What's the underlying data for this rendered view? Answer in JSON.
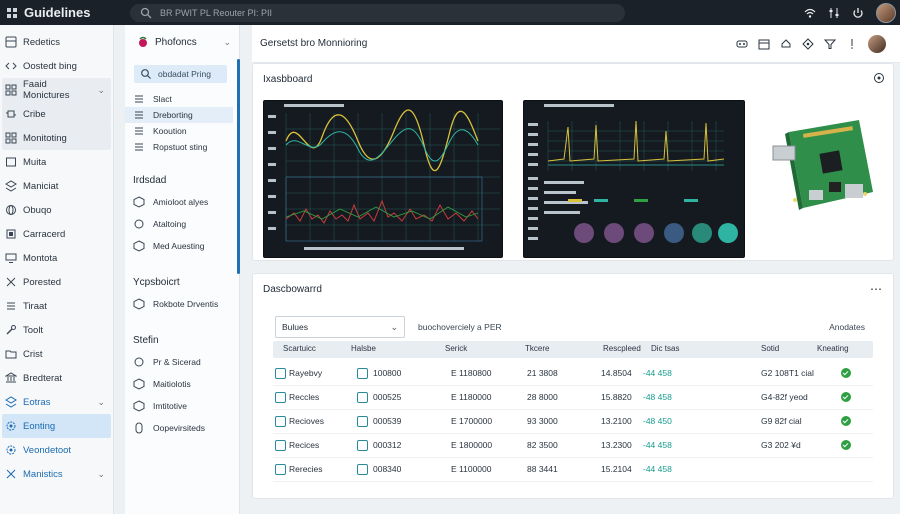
{
  "topbar": {
    "title": "Guidelines",
    "search_text": "BR PWIT PL Reouter PI: PII",
    "icons": [
      "apps-icon",
      "search-icon",
      "wifi-icon",
      "settings-sliders-icon",
      "power-icon",
      "avatar"
    ]
  },
  "rail": {
    "items": [
      {
        "label": "Redetics",
        "icon": "dashboard-icon",
        "boxed": false,
        "active": false,
        "blue": false,
        "chevron": false
      },
      {
        "label": "Oostedt bing",
        "icon": "code-icon",
        "boxed": false,
        "active": false,
        "blue": false,
        "chevron": false
      },
      {
        "label": "Faaid Monictures",
        "icon": "grid-icon",
        "boxed": true,
        "active": false,
        "blue": false,
        "chevron": true
      },
      {
        "label": "Cribe",
        "icon": "chip-icon",
        "boxed": true,
        "active": false,
        "blue": false,
        "chevron": false
      },
      {
        "label": "Monitoting",
        "icon": "grid-icon",
        "boxed": true,
        "active": false,
        "blue": false,
        "chevron": false
      },
      {
        "label": "Muita",
        "icon": "box-icon",
        "boxed": false,
        "active": false,
        "blue": false,
        "chevron": false
      },
      {
        "label": "Maniciat",
        "icon": "layers-icon",
        "boxed": false,
        "active": false,
        "blue": false,
        "chevron": false
      },
      {
        "label": "Obuqo",
        "icon": "globe-icon",
        "boxed": false,
        "active": false,
        "blue": false,
        "chevron": false
      },
      {
        "label": "Carracerd",
        "icon": "cpu-icon",
        "boxed": false,
        "active": false,
        "blue": false,
        "chevron": false
      },
      {
        "label": "Montota",
        "icon": "monitor-icon",
        "boxed": false,
        "active": false,
        "blue": false,
        "chevron": false
      },
      {
        "label": "Porested",
        "icon": "tools-icon",
        "boxed": false,
        "active": false,
        "blue": false,
        "chevron": false
      },
      {
        "label": "Tiraat",
        "icon": "list-icon",
        "boxed": false,
        "active": false,
        "blue": false,
        "chevron": false
      },
      {
        "label": "Toolt",
        "icon": "wrench-icon",
        "boxed": false,
        "active": false,
        "blue": false,
        "chevron": false
      },
      {
        "label": "Crist",
        "icon": "folder-icon",
        "boxed": false,
        "active": false,
        "blue": false,
        "chevron": false
      },
      {
        "label": "Bredterat",
        "icon": "bank-icon",
        "boxed": false,
        "active": false,
        "blue": false,
        "chevron": false
      },
      {
        "label": "Eotras",
        "icon": "layers-icon",
        "boxed": false,
        "active": false,
        "blue": true,
        "chevron": true
      },
      {
        "label": "Eonting",
        "icon": "gear-icon",
        "boxed": false,
        "active": true,
        "blue": true,
        "chevron": false
      },
      {
        "label": "Veondetoot",
        "icon": "gear-icon",
        "boxed": false,
        "active": false,
        "blue": true,
        "chevron": false
      },
      {
        "label": "Manistics",
        "icon": "close-icon",
        "boxed": false,
        "active": false,
        "blue": true,
        "chevron": true
      }
    ]
  },
  "side": {
    "title": "Phofoncs",
    "search_text": "obdadat Pring",
    "group1": [
      {
        "label": "Slact",
        "icon": "list-icon",
        "selected": false
      },
      {
        "label": "Dreborting",
        "icon": "list-icon",
        "selected": true
      },
      {
        "label": "Kooution",
        "icon": "list-icon",
        "selected": false
      },
      {
        "label": "Ropstuot sting",
        "icon": "list-icon",
        "selected": false
      }
    ],
    "section2": "Irdsdad",
    "group2": [
      {
        "label": "Amioloot alyes",
        "icon": "cube-icon",
        "selected": false
      },
      {
        "label": "Ataltoing",
        "icon": "circle-icon",
        "selected": false
      },
      {
        "label": "Med Auesting",
        "icon": "cube-icon",
        "selected": false
      }
    ],
    "section3": "Ycpsboicrt",
    "group3": [
      {
        "label": "Rokbote Drventis",
        "icon": "cube-icon",
        "selected": false
      }
    ],
    "section4": "Stefin",
    "group4": [
      {
        "label": "Pr & Sicerad",
        "icon": "circle-icon",
        "selected": false
      },
      {
        "label": "Maitiolotis",
        "icon": "cube-icon",
        "selected": false
      },
      {
        "label": "Imtitotive",
        "icon": "cube-icon",
        "selected": false
      },
      {
        "label": "Oopevirsiteds",
        "icon": "clip-icon",
        "selected": false
      }
    ]
  },
  "main": {
    "title": "Gersetst bro Monnioring",
    "card1_title": "Ixasbboard",
    "card2_title": "Dascbowarrd",
    "colors": {
      "accent": "#1f6fb5",
      "scope_bg": "#151a20",
      "wave_yellow": "#d9c13a",
      "wave_teal": "#2fb3a3",
      "wave_red": "#c73c3c",
      "green": "#2ea043"
    },
    "table": {
      "control_label": "Bulues",
      "hint": "buochoverciely a PER",
      "annotation": "Anodates",
      "columns": [
        "Scartuicc",
        "Halsbe",
        "Serick",
        "Tkcere",
        "Rescpleed",
        "Dic tsas",
        "Sotid",
        "Kneating"
      ],
      "rows": [
        [
          "Rayebvy",
          "100800",
          "E 1180800",
          "21 3808",
          "14.8504",
          "-44 458",
          "G2 108T1 cial"
        ],
        [
          "Reccles",
          "000525",
          "E 1180000",
          "28 8000",
          "15.8820",
          "-48 458",
          "G4-82f yeod"
        ],
        [
          "Recioves",
          "000539",
          "E 1700000",
          "93 3000",
          "13.2100",
          "-48 450",
          "G9 82f cial"
        ],
        [
          "Recices",
          "000312",
          "E 1800000",
          "82 3500",
          "13.2300",
          "-44 458",
          "G3 202 ¥d"
        ],
        [
          "Rerecies",
          "008340",
          "E 1100000",
          "88 3441",
          "15.2104",
          "-44 458",
          ""
        ]
      ]
    }
  }
}
